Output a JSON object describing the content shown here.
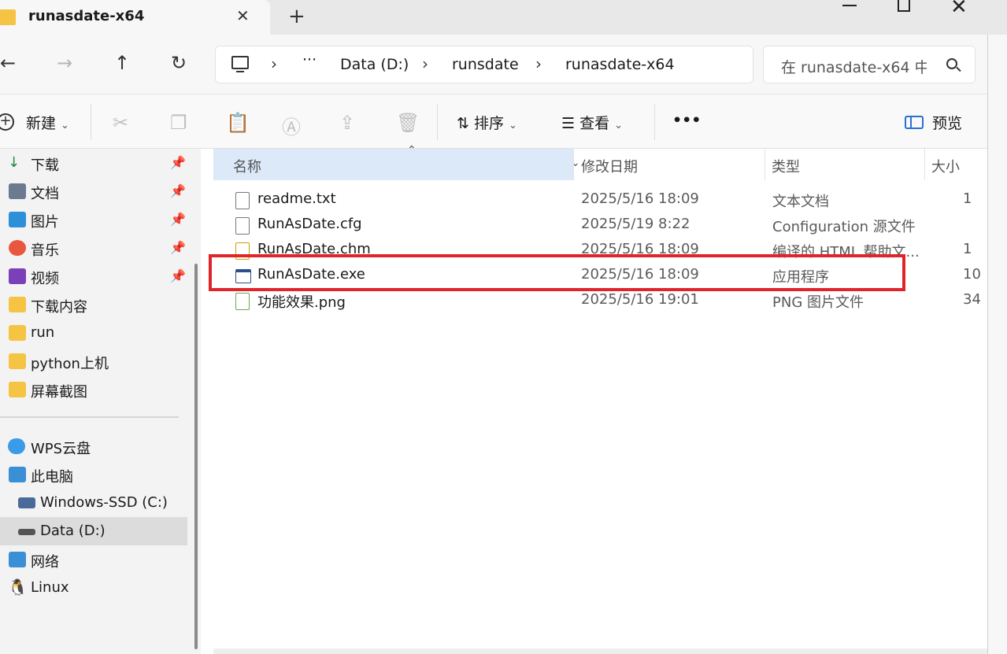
{
  "window": {
    "tab_title": "runasdate-x64",
    "close_tab_glyph": "✕",
    "new_tab_glyph": "+"
  },
  "nav": {
    "back_glyph": "←",
    "forward_glyph": "→",
    "up_glyph": "↑",
    "refresh_glyph": "↻"
  },
  "address": {
    "ellipsis": "···",
    "segments": [
      "Data (D:)",
      "runsdate",
      "runasdate-x64"
    ],
    "chevron": "›"
  },
  "search": {
    "placeholder": "在 runasdate-x64 中"
  },
  "toolbar": {
    "new_label": "新建",
    "sort_label": "排序",
    "view_label": "查看",
    "more_glyph": "•••",
    "preview_label": "预览",
    "dropdown_glyph": "⌄"
  },
  "sidebar": {
    "quick_access": [
      {
        "label": "下载",
        "icon": "download-icon",
        "pinned": true
      },
      {
        "label": "文档",
        "icon": "documents-icon",
        "pinned": true
      },
      {
        "label": "图片",
        "icon": "pictures-icon",
        "pinned": true
      },
      {
        "label": "音乐",
        "icon": "music-icon",
        "pinned": true
      },
      {
        "label": "视频",
        "icon": "videos-icon",
        "pinned": true
      },
      {
        "label": "下载内容",
        "icon": "folder-icon",
        "pinned": false
      },
      {
        "label": "run",
        "icon": "folder-icon",
        "pinned": false
      },
      {
        "label": "python上机",
        "icon": "folder-icon",
        "pinned": false
      },
      {
        "label": "屏幕截图",
        "icon": "folder-icon",
        "pinned": false
      }
    ],
    "locations": [
      {
        "label": "WPS云盘",
        "icon": "cloud-icon"
      },
      {
        "label": "此电脑",
        "icon": "computer-icon"
      },
      {
        "label": "Windows-SSD (C:)",
        "icon": "windows-drive-icon"
      },
      {
        "label": "Data (D:)",
        "icon": "drive-icon",
        "selected": true
      },
      {
        "label": "网络",
        "icon": "network-icon"
      },
      {
        "label": "Linux",
        "icon": "linux-icon"
      }
    ],
    "pin_glyph": "📌"
  },
  "table": {
    "columns": [
      "名称",
      "修改日期",
      "类型",
      "大小"
    ],
    "rows": [
      {
        "name": "readme.txt",
        "date": "2025/5/16 18:09",
        "type": "文本文档",
        "size": "1",
        "icon": "text-file-icon"
      },
      {
        "name": "RunAsDate.cfg",
        "date": "2025/5/19 8:22",
        "type": "Configuration 源文件",
        "size": "",
        "icon": "config-file-icon"
      },
      {
        "name": "RunAsDate.chm",
        "date": "2025/5/16 18:09",
        "type": "编译的 HTML 帮助文...",
        "size": "1",
        "icon": "help-file-icon"
      },
      {
        "name": "RunAsDate.exe",
        "date": "2025/5/16 18:09",
        "type": "应用程序",
        "size": "10",
        "icon": "exe-file-icon"
      },
      {
        "name": "功能效果.png",
        "date": "2025/5/16 19:01",
        "type": "PNG 图片文件",
        "size": "34",
        "icon": "image-file-icon"
      }
    ]
  },
  "colors": {
    "highlight": "#e0252a",
    "sorted_header": "#dbe9f8",
    "folder": "#f5c445"
  }
}
